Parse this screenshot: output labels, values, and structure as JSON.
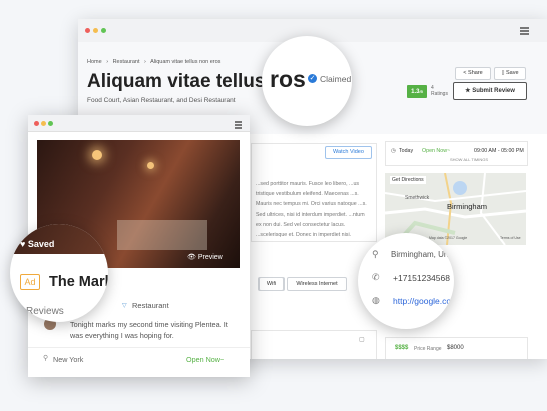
{
  "back_window": {
    "breadcrumb": [
      "Home",
      "Restaurant",
      "Aliquam vitae tellus non eros"
    ],
    "title": "Aliquam vitae tellus non eros",
    "claimed_label": "Claimed",
    "subtitle": "Food Court, Asian Restaurant, and Desi Restaurant",
    "share_label": "Share",
    "save_label": "Save",
    "rating_value": "1.3",
    "rating_scale": "/5",
    "rating_count": "4",
    "rating_label": "Ratings",
    "submit_review_label": "Submit Review",
    "watch_video_label": "Watch Video",
    "description": "...sed porttitor mauris. Fusce leo libero, ...us tristique vestibulum eleifend. Maecenas ...s. Mauris nec tempus mi. Orci varius natoque ...s. Sed ultrices, nisi id interdum imperdiet. ...ntum ex non dui. Sed vel consectetur lacus. ...scelerisque et. Donec in imperdiet nisi.",
    "tags": [
      "Wifi",
      "Wireless Internet"
    ],
    "hours": {
      "today_label": "Today",
      "status": "Open Now~",
      "range": "09:00 AM - 05:00 PM",
      "show_all": "SHOW ALL TIMINGS"
    },
    "map": {
      "directions": "Get Directions",
      "city": "Birmingham",
      "place": "Smethwick",
      "copyright": "Map data ©2017 Google",
      "terms": "Terms of Use"
    },
    "contact": {
      "address": "Birmingham, United Kingdom",
      "phone": "+17151234568",
      "website": "http://google.com"
    },
    "price": {
      "symbol": "$$$$",
      "label": "Price Range",
      "value": "$8000"
    },
    "magnifier_fragment": "ros",
    "magnifier_claimed": "Claimed"
  },
  "front_window": {
    "saved_label": "Saved",
    "preview_label": "Preview",
    "ad_label": "Ad",
    "listing_title": "The Mark Hotel",
    "category": "Restaurant",
    "reviews_label": "Reviews",
    "review_text": "Tonight marks my second time visiting Plentea. It was everything I was hoping for.",
    "location": "New York",
    "status": "Open Now~"
  },
  "colors": {
    "accent": "#2a7ad8",
    "green": "#56b145",
    "link": "#2b65d9"
  }
}
